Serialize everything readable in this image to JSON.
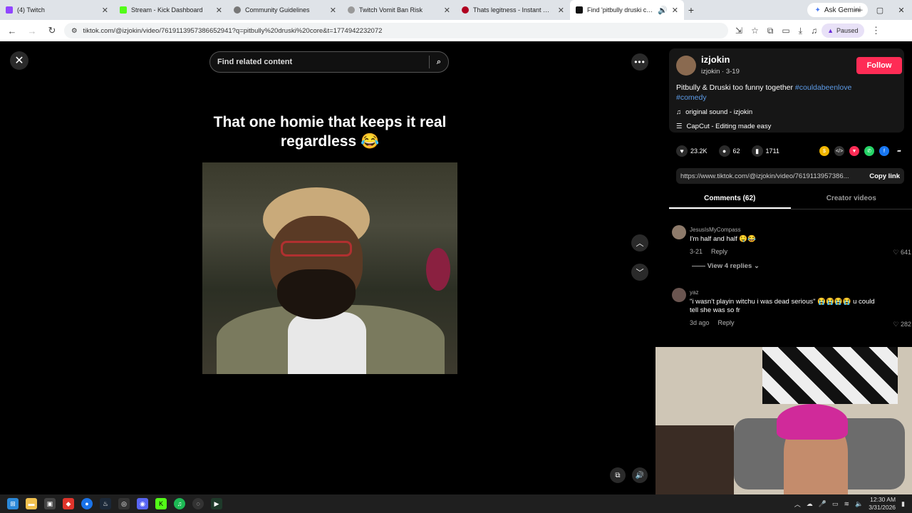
{
  "browser": {
    "tabs": [
      {
        "title": "(4) Twitch",
        "color": "#9146ff"
      },
      {
        "title": "Stream - Kick Dashboard",
        "color": "#53fc18"
      },
      {
        "title": "Community Guidelines",
        "color": "#777777"
      },
      {
        "title": "Twitch Vomit Ban Risk",
        "color": "#999999"
      },
      {
        "title": "Thats legitness - Instant Sound",
        "color": "#b00020"
      },
      {
        "title": "Find 'pitbully druski core' o",
        "color": "#111111"
      }
    ],
    "gemini_label": "Ask Gemini",
    "url": "tiktok.com/@izjokin/video/7619113957386652941?q=pitbully%20druski%20core&t=1774942232072",
    "profile_status": "Paused"
  },
  "video": {
    "search_placeholder": "Find related content",
    "caption": "That one homie that keeps it real regardless 😂"
  },
  "post": {
    "username": "izjokin",
    "sub": "izjokin · 3-19",
    "follow_label": "Follow",
    "desc_text": "Pitbully & Druski too funny together ",
    "tag1": "#couldabeenlove",
    "tag2": "#comedy",
    "sound": "original sound - izjokin",
    "capcut": "CapCut - Editing made easy",
    "likes": "23.2K",
    "comments_count": "62",
    "saves": "1711",
    "link": "https://www.tiktok.com/@izjokin/video/7619113957386...",
    "copy_label": "Copy link",
    "tab_comments": "Comments (62)",
    "tab_creator": "Creator videos"
  },
  "comments": [
    {
      "user": "JesusIsMyCompass",
      "text": "I'm half and half 🤤😂",
      "date": "3-21",
      "reply": "Reply",
      "likes": "641"
    },
    {
      "user": "yaz",
      "text": "\"i wasn't playin witchu i was dead serious\" 😭😭😭😭 u could tell she was so fr",
      "date": "3d ago",
      "reply": "Reply",
      "likes": "282"
    }
  ],
  "view_replies": "View 4 replies",
  "taskbar": {
    "time": "12:30 AM",
    "date": "3/31/2026"
  }
}
